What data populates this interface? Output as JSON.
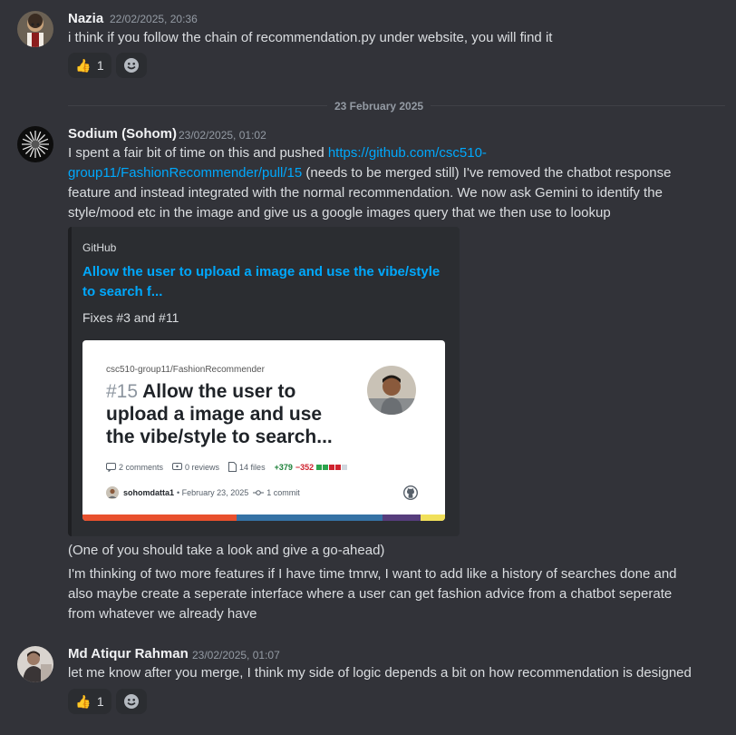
{
  "messages": [
    {
      "author": "Nazia",
      "timestamp": "22/02/2025, 20:36",
      "lines": [
        "i think if you follow the chain of recommendation.py under website, you will find it"
      ],
      "reaction": {
        "emoji": "👍",
        "count": "1"
      }
    },
    {
      "author": "Sodium (Sohom)",
      "timestamp": "23/02/2025, 01:02",
      "intro": "I spent a fair bit of time on this and pushed ",
      "link_line1": "https://github.com/csc510-",
      "link_line2": "group11/FashionRecommender/pull/15",
      "after_link": " (needs to be merged still) I've removed the chatbot response",
      "lines": [
        "feature and instead integrated with the normal recommendation. We now ask Gemini to identify the",
        "style/mood etc in the image and give us a google images query that we then use to lookup"
      ],
      "embed": {
        "provider": "GitHub",
        "title_line1": "Allow the user to upload a image and use the vibe/style",
        "title_line2": "to search f...",
        "description": "Fixes #3 and #11",
        "card": {
          "repo": "csc510-group11/FashionRecommender",
          "pr_number": "#15",
          "title_line1": "Allow the user to",
          "title_line2": "upload a image and use",
          "title_line3": "the vibe/style to search...",
          "comments": "2 comments",
          "reviews": "0 reviews",
          "files": "14 files",
          "additions": "+379",
          "deletions": "−352",
          "author": "sohomdatta1",
          "date": "• February 23, 2025",
          "commits": "1 commit"
        }
      },
      "after_lines": [
        "(One of you should take a look and give a go-ahead)",
        "I'm thinking of two more features if I have time tmrw, I want to add like a history of searches done and",
        "also maybe create a seperate interface where a user can get fashion advice from a chatbot seperate",
        "from whatever we already have"
      ]
    },
    {
      "author": "Md Atiqur Rahman",
      "timestamp": "23/02/2025, 01:07",
      "lines": [
        "let me know after you merge, I think my side of logic depends a bit on how recommendation is designed"
      ],
      "reaction": {
        "emoji": "👍",
        "count": "1"
      }
    }
  ],
  "date_divider": "23 February 2025",
  "icons": [
    "thumbs-up-icon",
    "add-reaction-icon",
    "comment-icon",
    "review-icon",
    "file-icon",
    "commit-icon",
    "github-icon"
  ],
  "colors": {
    "background": "#323339",
    "link": "#00a8fc",
    "embed_bg": "#2b2d31",
    "bar_red": "#e8502d",
    "bar_blue": "#3572a5",
    "bar_purple": "#563d7c",
    "bar_yellow": "#f1e05a"
  }
}
